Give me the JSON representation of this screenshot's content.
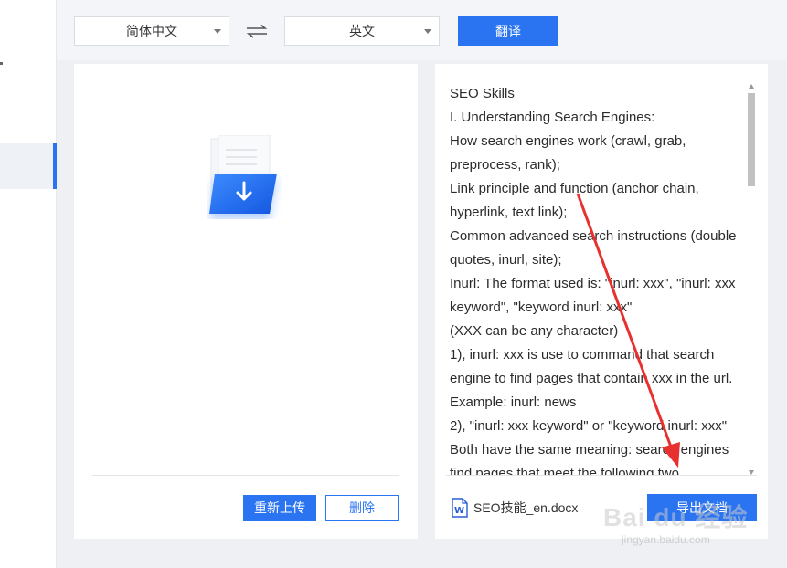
{
  "header": {
    "source_language": "简体中文",
    "target_language": "英文",
    "translate_label": "翻译"
  },
  "left_panel": {
    "reupload_label": "重新上传",
    "delete_label": "删除"
  },
  "right_panel": {
    "translated_lines": [
      "SEO Skills",
      "I. Understanding Search Engines:",
      "How search engines work (crawl, grab,",
      "preprocess, rank);",
      "Link principle and function (anchor chain,",
      "hyperlink, text link);",
      "Common advanced search instructions (double",
      "quotes, inurl, site);",
      "Inurl: The format used is: \"inurl: xxx\", \"inurl: xxx",
      "keyword\", \"keyword inurl: xxx\"",
      "(XXX can be any character)",
      "1), inurl: xxx is use to command that search",
      "engine to find pages that contain xxx in the url.",
      "Example: inurl: news",
      "2), \"inurl: xxx keyword\" or \"keyword inurl: xxx\"",
      "Both have the same meaning: search engines",
      "find pages that meet the following two"
    ],
    "file_name": "SEO技能_en.docx",
    "export_label": "导出文档"
  },
  "icons": {
    "swap": "swap-arrows-icon",
    "upload": "folder-download-icon",
    "word": "word-doc-icon"
  },
  "watermark": {
    "main": "Bai du 经验",
    "sub": "jingyan.baidu.com"
  },
  "colors": {
    "accent": "#2a74f1",
    "annotation_arrow": "#e8312f"
  }
}
